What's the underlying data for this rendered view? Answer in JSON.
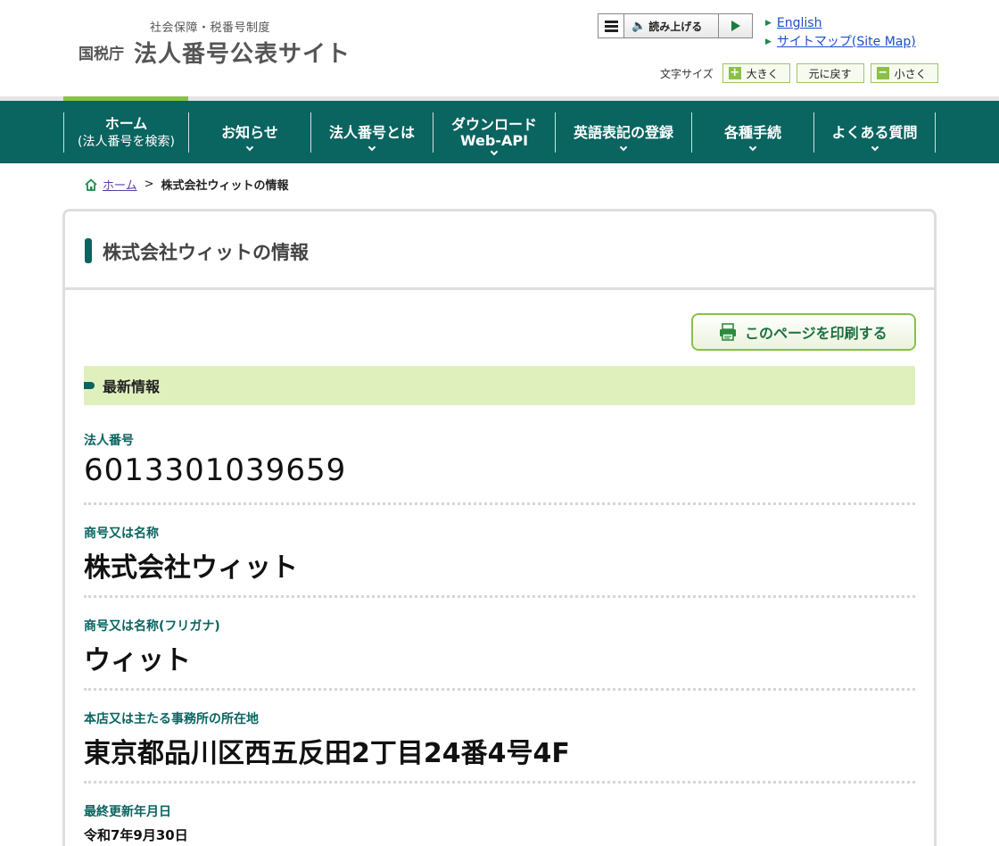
{
  "header": {
    "logo_subtitle": "社会保障・税番号制度",
    "logo_org": "国税庁",
    "logo_site": "法人番号公表サイト",
    "read_aloud_label": "読み上げる",
    "links": [
      {
        "label": "English"
      },
      {
        "label": "サイトマップ(Site Map)"
      }
    ],
    "font_size": {
      "label": "文字サイズ",
      "larger": "大きく",
      "reset": "元に戻す",
      "smaller": "小さく"
    }
  },
  "nav": {
    "items": [
      {
        "line1": "ホーム",
        "line2": "(法人番号を検索)"
      },
      {
        "line1": "お知らせ"
      },
      {
        "line1": "法人番号とは"
      },
      {
        "line1": "ダウンロード",
        "line2": "Web-API"
      },
      {
        "line1": "英語表記の登録"
      },
      {
        "line1": "各種手続"
      },
      {
        "line1": "よくある質問"
      }
    ]
  },
  "breadcrumb": {
    "home": "ホーム",
    "separator": ">",
    "current": "株式会社ウィットの情報"
  },
  "main": {
    "title": "株式会社ウィットの情報",
    "print_label": "このページを印刷する",
    "section_title": "最新情報",
    "fields": [
      {
        "label": "法人番号",
        "value": "6013301039659"
      },
      {
        "label": "商号又は名称",
        "value": "株式会社ウィット"
      },
      {
        "label": "商号又は名称(フリガナ)",
        "value": "ウィット"
      },
      {
        "label": "本店又は主たる事務所の所在地",
        "value": "東京都品川区西五反田2丁目24番4号4F"
      },
      {
        "label": "最終更新年月日",
        "value": "令和7年9月30日"
      }
    ]
  },
  "colors": {
    "nav_bg": "#0a6460",
    "accent_green": "#8ac049",
    "section_bg": "#e0f0bd",
    "link_blue": "#1a4fc9"
  }
}
